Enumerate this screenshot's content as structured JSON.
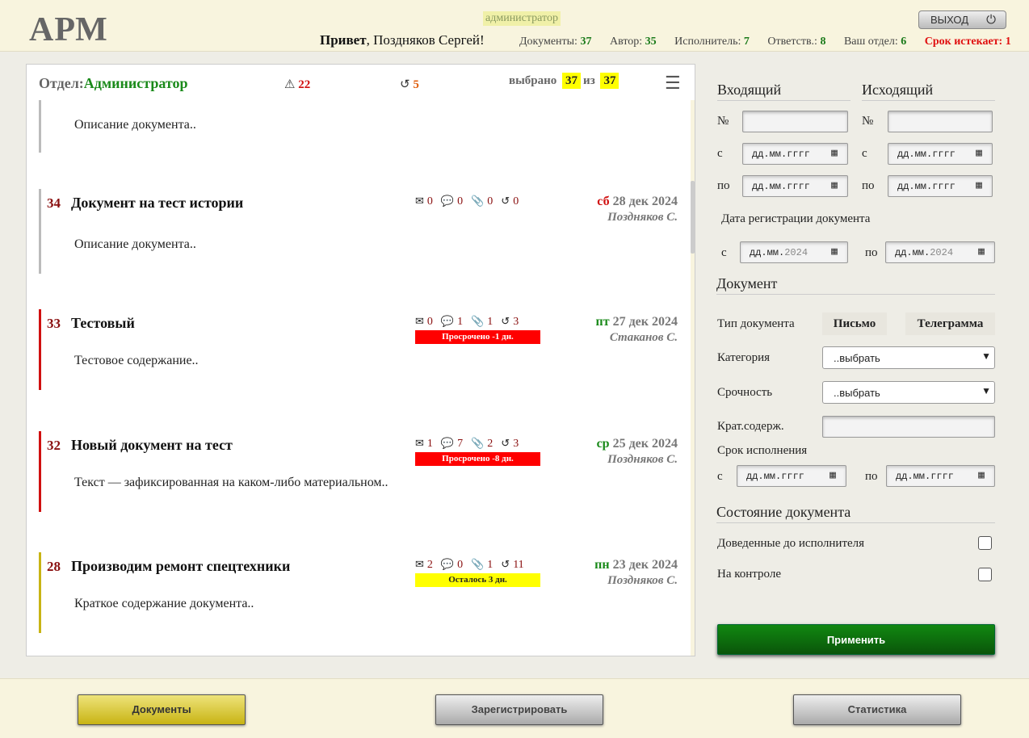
{
  "header": {
    "logo": "АРМ",
    "role": "администратор",
    "greeting_bold": "Привет",
    "greeting_rest": ", Поздняков Сергей!",
    "stats": [
      {
        "label": "Документы:",
        "value": "37"
      },
      {
        "label": "Автор:",
        "value": "35"
      },
      {
        "label": "Исполнитель:",
        "value": "7"
      },
      {
        "label": "Ответств.:",
        "value": "8"
      },
      {
        "label": "Ваш отдел:",
        "value": "6"
      }
    ],
    "deadline_label": "Срок истекает:",
    "deadline_value": "1",
    "exit_label": "ВЫХОД"
  },
  "list_header": {
    "dept_label": "Отдел:",
    "dept_value": "Администратор",
    "warnings": "22",
    "history": "5",
    "selected_label": "выбрано",
    "selected": "37",
    "of_label": "из",
    "total": "37"
  },
  "documents": [
    {
      "num": "",
      "title": "",
      "desc": "Описание документа..",
      "bar": "#bbbbbb"
    },
    {
      "num": "34",
      "title": "Документ на тест истории",
      "desc": "Описание документа..",
      "bar": "#bbbbbb",
      "mail": "0",
      "comments": "0",
      "attachments": "0",
      "history": "0",
      "badge": "",
      "badge_color": "",
      "day": "сб",
      "day_color": "red",
      "date": "28 дек 2024",
      "author": "Поздняков С."
    },
    {
      "num": "33",
      "title": "Тестовый",
      "desc": "Тестовое содержание..",
      "bar": "#d01010",
      "mail": "0",
      "comments": "1",
      "attachments": "1",
      "history": "3",
      "badge": "Просрочено -1 дн.",
      "badge_color": "#ff0000",
      "day": "пт",
      "day_color": "green",
      "date": "27 дек 2024",
      "author": "Стаканов С."
    },
    {
      "num": "32",
      "title": "Новый документ на тест",
      "desc": "Текст — зафиксированная на каком-либо материальном..",
      "bar": "#d01010",
      "mail": "1",
      "comments": "7",
      "attachments": "2",
      "history": "3",
      "badge": "Просрочено -8 дн.",
      "badge_color": "#ff0000",
      "day": "ср",
      "day_color": "green",
      "date": "25 дек 2024",
      "author": "Поздняков С."
    },
    {
      "num": "28",
      "title": "Производим ремонт спецтехники",
      "desc": "Краткое содержание документа..",
      "bar": "#c8b414",
      "mail": "2",
      "comments": "0",
      "attachments": "1",
      "history": "11",
      "badge": "Осталось 3 дн.",
      "badge_color": "#ffff00",
      "day": "пн",
      "day_color": "green",
      "date": "23 дек 2024",
      "author": "Поздняков С."
    }
  ],
  "filters": {
    "incoming": "Входящий",
    "outgoing": "Исходящий",
    "num_label": "№",
    "from_label": "с",
    "to_label": "по",
    "date_placeholder": "дд.мм.гггг",
    "reg_date_label": "Дата регистрации документа",
    "reg_date_prefix": "дд.мм.",
    "reg_date_year": "2024",
    "document_section": "Документ",
    "doc_type_label": "Тип документа",
    "type_letter": "Письмо",
    "type_telegram": "Телеграмма",
    "category_label": "Категория",
    "category_value": "..выбрать",
    "urgency_label": "Срочность",
    "urgency_value": "..выбрать",
    "summary_label": "Крат.содерж.",
    "deadline_label": "Срок исполнения",
    "state_section": "Состояние документа",
    "delivered_label": "Доведенные до исполнителя",
    "control_label": "На контроле",
    "apply": "Применить"
  },
  "footer": {
    "documents": "Документы",
    "register": "Зарегистрировать",
    "statistics": "Статистика"
  },
  "icons": [
    "exit-icon",
    "warning-icon",
    "history-icon",
    "list-add-icon",
    "mail-icon",
    "comment-icon",
    "attachment-icon",
    "history-icon",
    "calendar-icon",
    "chevron-down-icon"
  ]
}
